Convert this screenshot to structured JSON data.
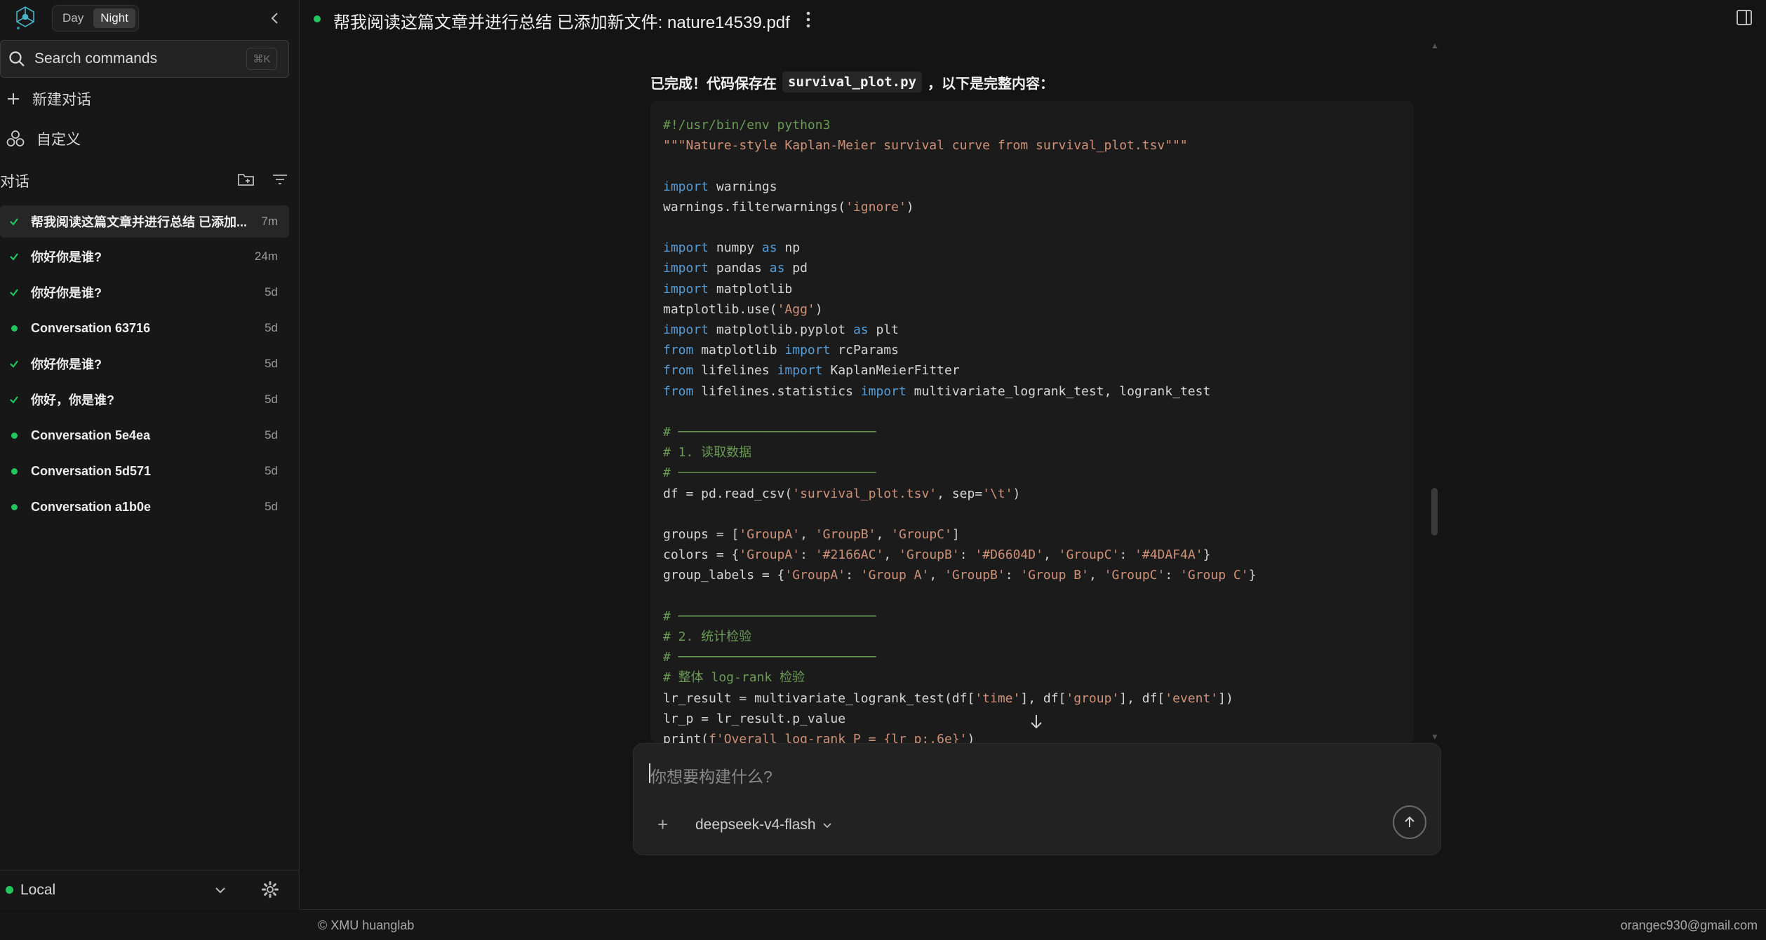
{
  "theme": {
    "day_label": "Day",
    "night_label": "Night",
    "active": "Night"
  },
  "search": {
    "label": "Search commands",
    "shortcut": "⌘K"
  },
  "nav": {
    "new_chat": "新建对话",
    "customize": "自定义"
  },
  "section": {
    "title": "对话"
  },
  "conversations": [
    {
      "title": "帮我阅读这篇文章并进行总结 已添加...",
      "time": "7m",
      "status": "done",
      "active": true
    },
    {
      "title": "你好你是谁?",
      "time": "24m",
      "status": "done"
    },
    {
      "title": "你好你是谁?",
      "time": "5d",
      "status": "done"
    },
    {
      "title": "Conversation 63716",
      "time": "5d",
      "status": "dot"
    },
    {
      "title": "你好你是谁?",
      "time": "5d",
      "status": "done"
    },
    {
      "title": "你好，你是谁?",
      "time": "5d",
      "status": "done"
    },
    {
      "title": "Conversation 5e4ea",
      "time": "5d",
      "status": "dot"
    },
    {
      "title": "Conversation 5d571",
      "time": "5d",
      "status": "dot"
    },
    {
      "title": "Conversation a1b0e",
      "time": "5d",
      "status": "dot"
    }
  ],
  "environment": {
    "label": "Local"
  },
  "header": {
    "title": "帮我阅读这篇文章并进行总结 已添加新文件: nature14539.pdf"
  },
  "message": {
    "intro_before": "已完成！代码保存在",
    "intro_code": "survival_plot.py",
    "intro_after": "，以下是完整内容："
  },
  "code": {
    "l01": "#!/usr/bin/env python3",
    "l02": "\"\"\"Nature-style Kaplan-Meier survival curve from survival_plot.tsv\"\"\"",
    "k_import": "import",
    "k_from": "from",
    "k_as": "as",
    "t_warnings": " warnings",
    "l05": "warnings.filterwarnings(",
    "s_ignore": "'ignore'",
    "close_paren": ")",
    "t_numpy": " numpy ",
    "t_np": " np",
    "t_pandas": " pandas ",
    "t_pd": " pd",
    "t_matplotlib": " matplotlib",
    "l10": "matplotlib.use(",
    "s_agg": "'Agg'",
    "t_pyplot": " matplotlib.pyplot ",
    "t_plt": " plt",
    "t_mpl_from": " matplotlib ",
    "t_rcparams": " rcParams",
    "t_lifelines": " lifelines ",
    "t_kmf": " KaplanMeierFitter",
    "t_lifestats": " lifelines.statistics ",
    "t_tests": " multivariate_logrank_test, logrank_test",
    "c_rule": "# ──────────────────────────",
    "c_sec1": "# 1. 读取数据",
    "l21a": "df = pd.read_csv(",
    "s_tsv": "'survival_plot.tsv'",
    "l21b": ", sep=",
    "s_tab": "'\\t'",
    "l23a": "groups = [",
    "s_ga": "'GroupA'",
    "s_gb": "'GroupB'",
    "s_gc": "'GroupC'",
    "comma": ", ",
    "l23b": "]",
    "l24a": "colors = {",
    "colon": ": ",
    "s_c1": "'#2166AC'",
    "s_c2": "'#D6604D'",
    "s_c3": "'#4DAF4A'",
    "rbrace": "}",
    "l25a": "group_labels = {",
    "s_la": "'Group A'",
    "s_lb": "'Group B'",
    "s_lc": "'Group C'",
    "c_sec2": "# 2. 统计检验",
    "c_overall": "# 整体 log-rank 检验",
    "l31a": "lr_result = multivariate_logrank_test(df[",
    "s_time": "'time'",
    "l31b": "], df[",
    "s_group": "'group'",
    "s_event": "'event'",
    "l31c": "])",
    "l32": "lr_p = lr_result.p_value",
    "l33a": "print(",
    "s_fstr": "f'Overall log-rank P = {lr_p:.6e}'"
  },
  "composer": {
    "placeholder": "你想要构建什么?",
    "model": "deepseek-v4-flash"
  },
  "footer": {
    "left": "© XMU huanglab",
    "right": "orangec930@gmail.com"
  }
}
